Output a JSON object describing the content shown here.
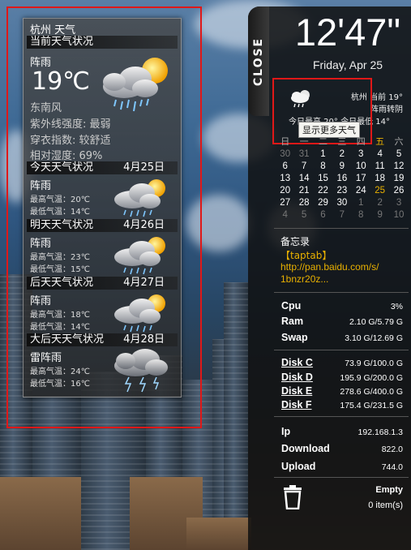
{
  "weather_panel": {
    "title": "杭州 天气",
    "current_header": "当前天气状况",
    "current_condition": "阵雨",
    "current_temp": "19℃",
    "wind": "东南风",
    "uv": "紫外线强度: 最弱",
    "dressing": "穿衣指数: 较舒适",
    "humidity": "相对湿度: 69%",
    "forecast": [
      {
        "header": "今天天气状况",
        "date": "4月25日",
        "condition": "阵雨",
        "high": "最高气温：20℃",
        "low": "最低气温：14℃",
        "icon": "rain-sun-icon"
      },
      {
        "header": "明天天气状况",
        "date": "4月26日",
        "condition": "阵雨",
        "high": "最高气温：23℃",
        "low": "最低气温：15℃",
        "icon": "rain-sun-icon"
      },
      {
        "header": "后天天气状况",
        "date": "4月27日",
        "condition": "阵雨",
        "high": "最高气温：18℃",
        "low": "最低气温：14℃",
        "icon": "rain-sun-icon"
      },
      {
        "header": "大后天天气状况",
        "date": "4月28日",
        "condition": "雷阵雨",
        "high": "最高气温：24℃",
        "low": "最低气温：16℃",
        "icon": "thunderstorm-icon"
      }
    ]
  },
  "sidebar": {
    "close_label": "CLOSE",
    "time": "12'47\"",
    "date": "Friday, Apr 25",
    "mini_weather": {
      "line1": "杭州 当前 19°",
      "line2": "阵雨转阴",
      "line3": "今日最高 20°  今日最低 14°",
      "tooltip": "显示更多天气"
    },
    "calendar": {
      "headers": [
        "日",
        "一",
        "二",
        "三",
        "四",
        "五",
        "六"
      ],
      "weeks": [
        [
          "30",
          "31",
          "1",
          "2",
          "3",
          "4",
          "5"
        ],
        [
          "6",
          "7",
          "8",
          "9",
          "10",
          "11",
          "12"
        ],
        [
          "13",
          "14",
          "15",
          "16",
          "17",
          "18",
          "19"
        ],
        [
          "20",
          "21",
          "22",
          "23",
          "24",
          "25",
          "26"
        ],
        [
          "27",
          "28",
          "29",
          "30",
          "1",
          "2",
          "3"
        ],
        [
          "4",
          "5",
          "6",
          "7",
          "8",
          "9",
          "10"
        ]
      ]
    },
    "memo": {
      "title": "备忘录",
      "tag": "【taptab】",
      "link_line1": "http://pan.baidu.com/s/",
      "link_line2": "1bnzr20z..."
    },
    "system": {
      "cpu_label": "Cpu",
      "cpu_value": "3%",
      "ram_label": "Ram",
      "ram_value": "2.10 G/5.79 G",
      "swap_label": "Swap",
      "swap_value": "3.10 G/12.69 G"
    },
    "disks": [
      {
        "label": "Disk C",
        "value": "73.9 G/100.0 G"
      },
      {
        "label": "Disk D",
        "value": "195.9 G/200.0 G"
      },
      {
        "label": "Disk E",
        "value": "278.6 G/400.0 G"
      },
      {
        "label": "Disk F",
        "value": "175.4 G/231.5 G"
      }
    ],
    "network": {
      "ip_label": "Ip",
      "ip_value": "192.168.1.3",
      "download_label": "Download",
      "download_value": "822.0",
      "upload_label": "Upload",
      "upload_value": "744.0"
    },
    "trash": {
      "empty_label": "Empty",
      "items": "0  item(s)"
    }
  },
  "colors": {
    "highlight": "#e01818",
    "accent": "#e8b000"
  }
}
